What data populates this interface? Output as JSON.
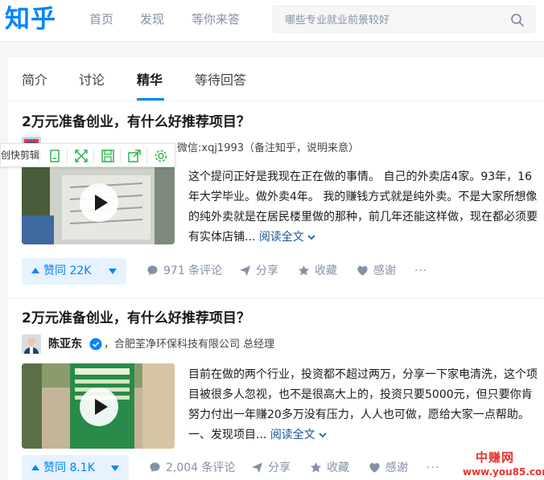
{
  "header": {
    "logo": "知乎",
    "nav": [
      "首页",
      "发现",
      "等你来答"
    ],
    "search": {
      "placeholder": "哪些专业就业前景较好"
    }
  },
  "tabs": [
    "简介",
    "讨论",
    "精华",
    "等待回答"
  ],
  "active_tab": "精华",
  "clip_toolbar": {
    "label": "创快剪辑"
  },
  "answers": [
    {
      "question": "2万元准备创业，有什么好推荐项目？",
      "author": "",
      "author_bio": "微信:xqj1993（备注知乎，说明来意）",
      "excerpt": "这个提问正好是我现在正在做的事情。 自己的外卖店4家。93年，16年大学毕业。做外卖4年。 我的赚钱方式就是纯外卖。不是大家所想像的纯外卖就是在居民楼里做的那种，前几年还能这样做，现在都必须要有实体店铺...",
      "read_more": "阅读全文",
      "vote_label": "赞同 22K",
      "comments": "971 条评论",
      "share": "分享",
      "favorite": "收藏",
      "thanks": "感谢",
      "more": "···"
    },
    {
      "question": "2万元准备创业，有什么好推荐项目？",
      "author": "陈亚东",
      "author_bio": "，合肥荃净环保科技有限公司 总经理",
      "excerpt": "目前在做的两个行业，投资都不超过两万，分享一下家电清洗，这个项目被很多人忽视，也不是很高大上的，投资只要5000元，但只要你肯努力付出一年赚20多万没有压力，人人也可做，愿给大家一点帮助。 一、发现项目...",
      "read_more": "阅读全文",
      "vote_label": "赞同 8.1K",
      "comments": "2,004 条评论",
      "share": "分享",
      "favorite": "收藏",
      "thanks": "感谢",
      "more": "···"
    }
  ],
  "watermark": {
    "name": "中赚网",
    "url": "www.you85.com"
  },
  "colors": {
    "brand": "#0084ff",
    "link": "#175199",
    "muted": "#8590a6",
    "vote_bg": "#e7f2ff",
    "watermark": "#e8322d"
  }
}
